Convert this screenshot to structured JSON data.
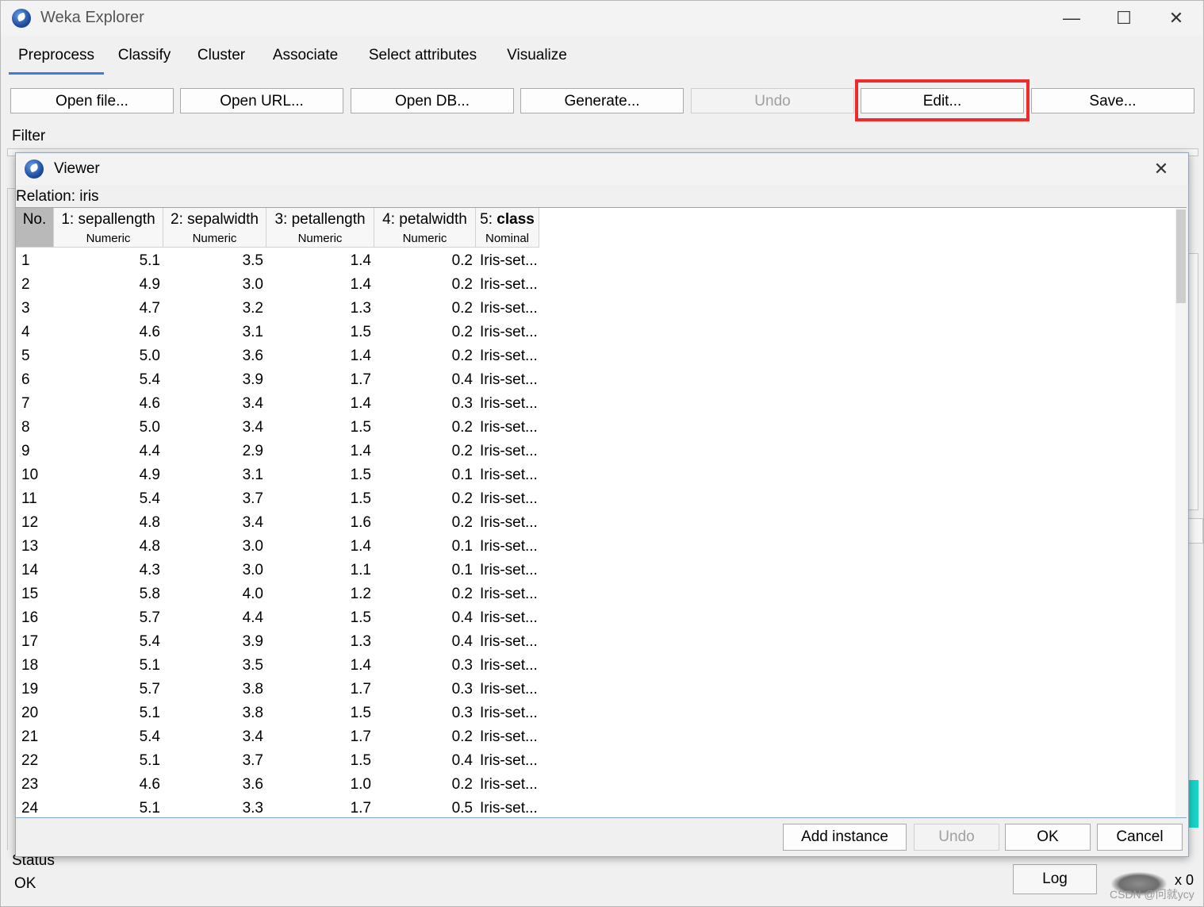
{
  "window": {
    "title": "Weka Explorer",
    "minimize": "—",
    "maximize": "☐",
    "close": "✕"
  },
  "tabs": [
    {
      "label": "Preprocess"
    },
    {
      "label": "Classify"
    },
    {
      "label": "Cluster"
    },
    {
      "label": "Associate"
    },
    {
      "label": "Select attributes"
    },
    {
      "label": "Visualize"
    }
  ],
  "toolbar": {
    "open_file": "Open file...",
    "open_url": "Open URL...",
    "open_db": "Open DB...",
    "generate": "Generate...",
    "undo": "Undo",
    "edit": "Edit...",
    "save": "Save..."
  },
  "filter_label": "Filter",
  "viewer": {
    "title": "Viewer",
    "close": "✕",
    "relation": "Relation: iris",
    "columns": [
      {
        "top": "No.",
        "sub": ""
      },
      {
        "top": "1: sepallength",
        "sub": "Numeric"
      },
      {
        "top": "2: sepalwidth",
        "sub": "Numeric"
      },
      {
        "top": "3: petallength",
        "sub": "Numeric"
      },
      {
        "top": "4: petalwidth",
        "sub": "Numeric"
      },
      {
        "prefix": "5: ",
        "name": "class",
        "sub": "Nominal"
      }
    ],
    "rows": [
      [
        "1",
        "5.1",
        "3.5",
        "1.4",
        "0.2",
        "Iris-set..."
      ],
      [
        "2",
        "4.9",
        "3.0",
        "1.4",
        "0.2",
        "Iris-set..."
      ],
      [
        "3",
        "4.7",
        "3.2",
        "1.3",
        "0.2",
        "Iris-set..."
      ],
      [
        "4",
        "4.6",
        "3.1",
        "1.5",
        "0.2",
        "Iris-set..."
      ],
      [
        "5",
        "5.0",
        "3.6",
        "1.4",
        "0.2",
        "Iris-set..."
      ],
      [
        "6",
        "5.4",
        "3.9",
        "1.7",
        "0.4",
        "Iris-set..."
      ],
      [
        "7",
        "4.6",
        "3.4",
        "1.4",
        "0.3",
        "Iris-set..."
      ],
      [
        "8",
        "5.0",
        "3.4",
        "1.5",
        "0.2",
        "Iris-set..."
      ],
      [
        "9",
        "4.4",
        "2.9",
        "1.4",
        "0.2",
        "Iris-set..."
      ],
      [
        "10",
        "4.9",
        "3.1",
        "1.5",
        "0.1",
        "Iris-set..."
      ],
      [
        "11",
        "5.4",
        "3.7",
        "1.5",
        "0.2",
        "Iris-set..."
      ],
      [
        "12",
        "4.8",
        "3.4",
        "1.6",
        "0.2",
        "Iris-set..."
      ],
      [
        "13",
        "4.8",
        "3.0",
        "1.4",
        "0.1",
        "Iris-set..."
      ],
      [
        "14",
        "4.3",
        "3.0",
        "1.1",
        "0.1",
        "Iris-set..."
      ],
      [
        "15",
        "5.8",
        "4.0",
        "1.2",
        "0.2",
        "Iris-set..."
      ],
      [
        "16",
        "5.7",
        "4.4",
        "1.5",
        "0.4",
        "Iris-set..."
      ],
      [
        "17",
        "5.4",
        "3.9",
        "1.3",
        "0.4",
        "Iris-set..."
      ],
      [
        "18",
        "5.1",
        "3.5",
        "1.4",
        "0.3",
        "Iris-set..."
      ],
      [
        "19",
        "5.7",
        "3.8",
        "1.7",
        "0.3",
        "Iris-set..."
      ],
      [
        "20",
        "5.1",
        "3.8",
        "1.5",
        "0.3",
        "Iris-set..."
      ],
      [
        "21",
        "5.4",
        "3.4",
        "1.7",
        "0.2",
        "Iris-set..."
      ],
      [
        "22",
        "5.1",
        "3.7",
        "1.5",
        "0.4",
        "Iris-set..."
      ],
      [
        "23",
        "4.6",
        "3.6",
        "1.0",
        "0.2",
        "Iris-set..."
      ],
      [
        "24",
        "5.1",
        "3.3",
        "1.7",
        "0.5",
        "Iris-set..."
      ]
    ],
    "buttons": {
      "add_instance": "Add instance",
      "undo": "Undo",
      "ok": "OK",
      "cancel": "Cancel"
    }
  },
  "status": {
    "label": "Status",
    "value": "OK",
    "log": "Log",
    "x_count": "x 0"
  },
  "watermark": "CSDN @问就ycy",
  "colors": {
    "highlight": "#ec2c2c",
    "tab_active": "#3d7fd6",
    "teal": "#18d6c8"
  }
}
